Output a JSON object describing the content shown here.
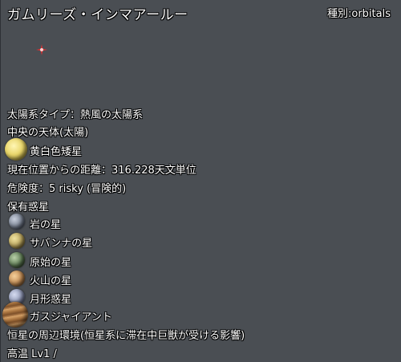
{
  "header": {
    "title": "ガムリーズ・インマアールー",
    "kind": "種別:orbitals"
  },
  "system": {
    "type_line": "太陽系タイプ：熱風の太陽系",
    "center_heading": "中央の天体(太陽)",
    "star_name": "黄白色矮星",
    "distance": "現在位置からの距離：316.228天文単位",
    "danger": "危険度：5 risky (冒険的)",
    "planets_heading": "保有惑星"
  },
  "planets": [
    {
      "name": "岩の星",
      "icon": "rocky-planet-icon",
      "color": "#8a93a3"
    },
    {
      "name": "サバンナの星",
      "icon": "savanna-planet-icon",
      "color": "#b9a45c"
    },
    {
      "name": "原始の星",
      "icon": "primordial-planet-icon",
      "color": "#5d7a53"
    },
    {
      "name": "火山の星",
      "icon": "volcanic-planet-icon",
      "color": "#c18a52"
    },
    {
      "name": "月形惑星",
      "icon": "moonlike-planet-icon",
      "color": "#8f97b5"
    },
    {
      "name": "ガスジャイアント",
      "icon": "gas-giant-icon",
      "color": "#a8733f"
    }
  ],
  "environment": {
    "heading": "恒星の周辺環境(恒星系に滞在中巨獣が受ける影響)",
    "value": "高温 Lv1 /"
  },
  "colors": {
    "background": "#4a4e53",
    "sparkle": "#ff2a2a",
    "star": "#e9d66a"
  }
}
